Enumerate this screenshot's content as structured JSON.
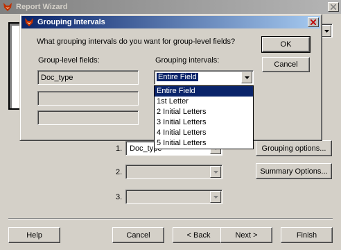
{
  "window": {
    "title": "Report Wizard"
  },
  "wizard": {
    "rows": [
      {
        "num": "1.",
        "value": "Doc_type"
      },
      {
        "num": "2.",
        "value": ""
      },
      {
        "num": "3.",
        "value": ""
      }
    ],
    "grouping_options_label": "Grouping options...",
    "summary_options_label": "Summary Options...",
    "help_label": "Help",
    "cancel_label": "Cancel",
    "back_label": "< Back",
    "next_label": "Next >",
    "finish_label": "Finish"
  },
  "dialog": {
    "title": "Grouping Intervals",
    "question": "What grouping intervals do you want for group-level fields?",
    "fields_header": "Group-level fields:",
    "intervals_header": "Grouping intervals:",
    "fields": [
      "Doc_type",
      "",
      ""
    ],
    "interval_selected": "Entire Field",
    "ok_label": "OK",
    "cancel_label": "Cancel",
    "interval_options": [
      "Entire Field",
      "1st Letter",
      "2 Initial Letters",
      "3 Initial Letters",
      "4 Initial Letters",
      "5 Initial Letters"
    ],
    "selected_option_index": 0
  },
  "colors": {
    "active_title": "#0a246a",
    "inactive_title": "#808080",
    "face": "#d4d0c8",
    "highlight": "#0a246a"
  },
  "icons": [
    "fox-app-icon",
    "close-icon",
    "dropdown-arrow-icon"
  ]
}
